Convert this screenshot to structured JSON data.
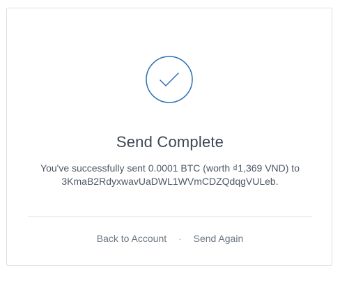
{
  "dialog": {
    "icon": "checkmark-circle-icon",
    "title": "Send Complete",
    "message_line1": "You've successfully sent 0.0001 BTC (worth ₫1,369 VND) to",
    "message_line2": "3KmaB2RdyxwavUaDWL1WVmCDZQdqgVULeb."
  },
  "actions": {
    "back_label": "Back to Account",
    "separator": "·",
    "send_again_label": "Send Again"
  },
  "colors": {
    "accent": "#2a6fb4",
    "title": "#3b4653",
    "text": "#4d5866",
    "link": "#6b7582",
    "border": "#dcdfe4"
  }
}
